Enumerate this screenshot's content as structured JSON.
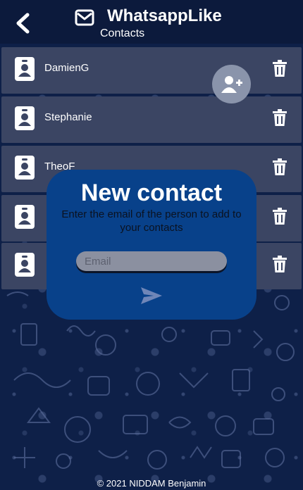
{
  "header": {
    "title": "WhatsappLike",
    "subtitle": "Contacts"
  },
  "contacts": [
    {
      "name": "DamienG"
    },
    {
      "name": "Stephanie"
    },
    {
      "name": "TheoF"
    },
    {
      "name": ""
    },
    {
      "name": ""
    }
  ],
  "modal": {
    "title": "New contact",
    "description": "Enter the email of the person to add to your contacts",
    "email_placeholder": "Email"
  },
  "footer": {
    "text": "© 2021 NIDDAM Benjamin"
  },
  "icons": {
    "back": "chevron-left-icon",
    "header": "envelope-icon",
    "contact": "id-badge-icon",
    "delete": "trash-icon",
    "add_contact": "user-plus-icon",
    "send": "paper-plane-icon"
  },
  "colors": {
    "header_bg": "#0c1a3c",
    "row_bg": "#3b4563",
    "modal_bg": "#08418a",
    "fab_bg": "#8a94ab"
  }
}
